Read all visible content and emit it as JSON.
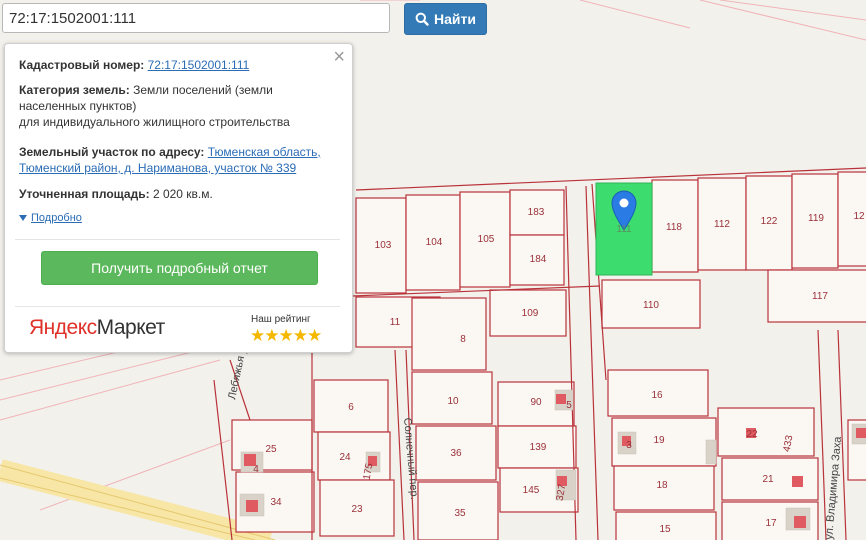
{
  "search": {
    "value": "72:17:1502001:111",
    "button_label": "Найти"
  },
  "popup": {
    "cadastral_label": "Кадастровый номер:",
    "cadastral_value": "72:17:1502001:111",
    "category_label": "Категория земель:",
    "category_value_line1": "Земли поселений (земли",
    "category_value_line2": "населенных пунктов)",
    "category_value_line3": "для индивидуального жилищного строительства",
    "address_label": "Земельный участок по адресу:",
    "address_line1": "Тюменская область,",
    "address_line2": "Тюменский район, д. Нариманова, участок № 339",
    "area_label": "Уточненная площадь:",
    "area_value": "2 020 кв.м.",
    "more_label": "Подробно",
    "report_button": "Получить подробный отчет",
    "brand_yandex": "Яндекс",
    "brand_market": "Маркет",
    "rating_label": "Наш рейтинг",
    "rating_stars": 5
  },
  "map": {
    "parcel_labels": [
      "103",
      "104",
      "105",
      "183",
      "184",
      "111",
      "118",
      "112",
      "122",
      "119",
      "12",
      "110",
      "117",
      "11",
      "8",
      "109",
      "6",
      "10",
      "90",
      "5",
      "16",
      "25",
      "24",
      "175",
      "36",
      "139",
      "19",
      "22",
      "433",
      "4",
      "34",
      "23",
      "145",
      "327",
      "18",
      "21",
      "35",
      "15",
      "17",
      "3"
    ],
    "streets": [
      "Лебяжья ул.",
      "Солнечный пер.",
      "ул. Владимира Заха"
    ],
    "selected_parcel": "111",
    "colors": {
      "parcel_border": "#b9323a",
      "selected_fill": "#3ddc6e",
      "pin": "#2a7be4"
    }
  }
}
